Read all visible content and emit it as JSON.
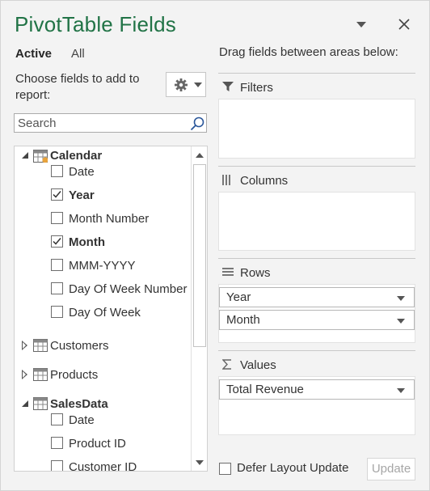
{
  "pane": {
    "title": "PivotTable Fields",
    "tabs": [
      {
        "label": "Active",
        "selected": true
      },
      {
        "label": "All",
        "selected": false
      }
    ],
    "choose_text": "Choose fields to add to report:",
    "search_placeholder": "Search"
  },
  "field_list": {
    "tables": [
      {
        "name": "Calendar",
        "expanded": true,
        "bold": true,
        "fields": [
          {
            "label": "Date",
            "checked": false
          },
          {
            "label": "Year",
            "checked": true
          },
          {
            "label": "Month Number",
            "checked": false
          },
          {
            "label": "Month",
            "checked": true
          },
          {
            "label": "MMM-YYYY",
            "checked": false
          },
          {
            "label": "Day Of Week Number",
            "checked": false
          },
          {
            "label": "Day Of Week",
            "checked": false
          }
        ]
      },
      {
        "name": "Customers",
        "expanded": false,
        "bold": false,
        "fields": []
      },
      {
        "name": "Products",
        "expanded": false,
        "bold": false,
        "fields": []
      },
      {
        "name": "SalesData",
        "expanded": true,
        "bold": true,
        "fields": [
          {
            "label": "Date",
            "checked": false
          },
          {
            "label": "Product ID",
            "checked": false
          },
          {
            "label": "Customer ID",
            "checked": false
          }
        ]
      }
    ]
  },
  "areas": {
    "drag_label": "Drag fields between areas below:",
    "filters": {
      "label": "Filters",
      "items": []
    },
    "columns": {
      "label": "Columns",
      "items": []
    },
    "rows": {
      "label": "Rows",
      "items": [
        "Year",
        "Month"
      ]
    },
    "values": {
      "label": "Values",
      "items": [
        "Total Revenue"
      ]
    }
  },
  "footer": {
    "defer_label": "Defer Layout Update",
    "defer_checked": false,
    "update_label": "Update"
  },
  "colors": {
    "title_green": "#217346",
    "pane_bg": "#f3f3f3"
  },
  "icons": {
    "dropdown": "chevron-down-icon",
    "close": "close-icon",
    "gear": "gear-icon",
    "search": "search-icon",
    "table": "table-icon",
    "filter": "filter-icon",
    "columns": "columns-icon",
    "rows": "rows-icon",
    "values": "sigma-icon"
  }
}
